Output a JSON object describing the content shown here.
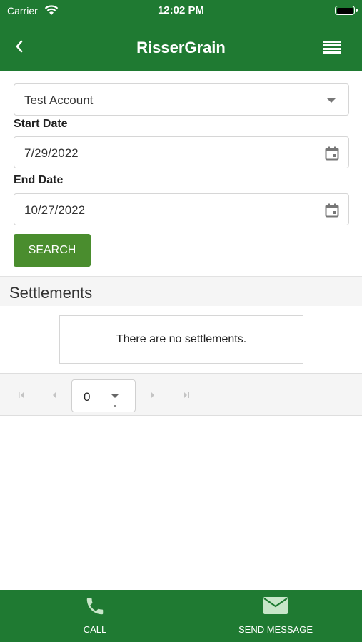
{
  "status_bar": {
    "carrier": "Carrier",
    "time": "12:02 PM"
  },
  "nav": {
    "title": "RisserGrain"
  },
  "form": {
    "account": {
      "selected": "Test Account"
    },
    "start_date": {
      "label": "Start Date",
      "value": "7/29/2022"
    },
    "end_date": {
      "label": "End Date",
      "value": "10/27/2022"
    },
    "search_label": "SEARCH"
  },
  "settlements": {
    "title": "Settlements",
    "empty_message": "There are no settlements."
  },
  "pager": {
    "page_size": "0"
  },
  "bottom_bar": {
    "call_label": "CALL",
    "message_label": "SEND MESSAGE"
  },
  "colors": {
    "brand_green": "#1f7a32",
    "button_green": "#4a8d2e"
  },
  "icons": [
    "wifi-icon",
    "battery-icon",
    "back-chevron-icon",
    "hamburger-menu-icon",
    "calendar-icon",
    "first-page-icon",
    "prev-page-icon",
    "next-page-icon",
    "last-page-icon",
    "phone-icon",
    "envelope-icon"
  ]
}
